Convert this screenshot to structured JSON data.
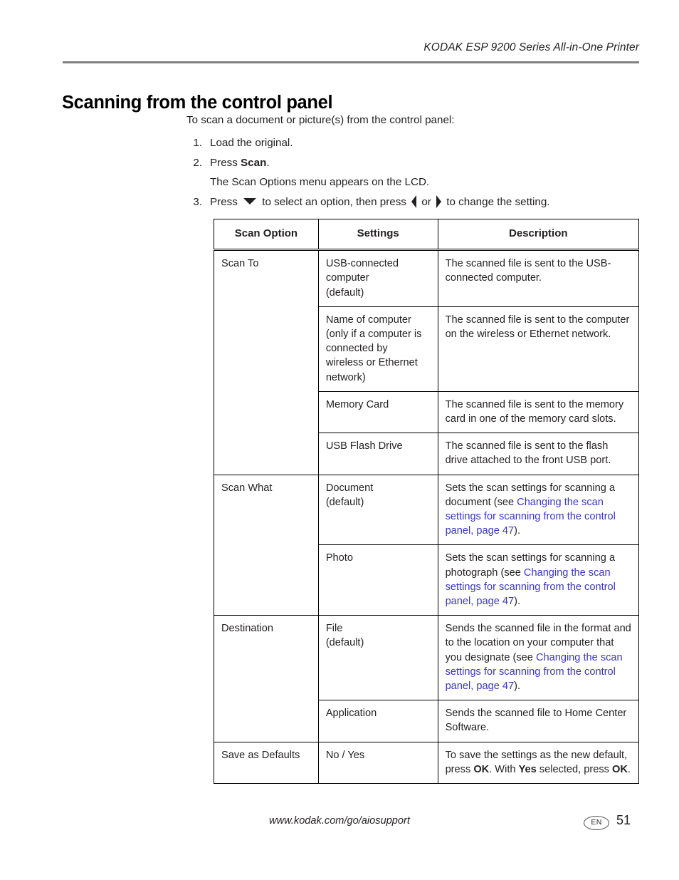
{
  "running_header": "KODAK ESP 9200 Series All-in-One Printer",
  "title": "Scanning from the control panel",
  "intro": "To scan a document or picture(s) from the control panel:",
  "steps": {
    "n1": "1.",
    "s1": "Load the original.",
    "n2": "2.",
    "s2_a": "Press ",
    "s2_b": "Scan",
    "s2_c": ".",
    "s2_sub": "The Scan Options menu appears on the LCD.",
    "n3": "3.",
    "s3_a": "Press ",
    "s3_b": " to select an option, then press ",
    "s3_c": " or ",
    "s3_d": " to change the setting."
  },
  "link_color": "#3a36c8",
  "rule_color": "#808080",
  "table": {
    "headers": {
      "option": "Scan Option",
      "settings": "Settings",
      "description": "Description"
    },
    "groups": [
      {
        "option": "Scan To",
        "rows": [
          {
            "setting": "USB-connected\ncomputer\n(default)",
            "desc_pre": "The scanned file is sent to the USB-connected computer.",
            "link": "",
            "desc_post": ""
          },
          {
            "setting": "Name of computer\n(only if a computer is\nconnected by\nwireless or Ethernet\nnetwork)",
            "desc_pre": "The scanned file is sent to the computer on the wireless or Ethernet network.",
            "link": "",
            "desc_post": ""
          },
          {
            "setting": "Memory Card",
            "desc_pre": "The scanned file is sent to the memory card in one of the memory card slots.",
            "link": "",
            "desc_post": ""
          },
          {
            "setting": "USB Flash Drive",
            "desc_pre": "The scanned file is sent to the flash drive attached to the front USB port.",
            "link": "",
            "desc_post": ""
          }
        ]
      },
      {
        "option": "Scan What",
        "rows": [
          {
            "setting": "Document\n(default)",
            "desc_pre": "Sets the scan settings for scanning a document (see ",
            "link": "Changing the scan settings for scanning from the control panel, page 47",
            "desc_post": ")."
          },
          {
            "setting": "Photo",
            "desc_pre": "Sets the scan settings for scanning a photograph (see ",
            "link": "Changing the scan settings for scanning from the control panel, page 47",
            "desc_post": ")."
          }
        ]
      },
      {
        "option": "Destination",
        "rows": [
          {
            "setting": "File\n(default)",
            "desc_pre": "Sends the scanned file in the format and to the location on your computer that you designate (see ",
            "link": "Changing the scan settings for scanning from the control panel, page 47",
            "desc_post": ")."
          },
          {
            "setting": "Application",
            "desc_pre": "Sends the scanned file to Home Center Software.",
            "link": "",
            "desc_post": ""
          }
        ]
      },
      {
        "option": "Save as Defaults",
        "rows": [
          {
            "setting": "No / Yes",
            "desc_pre": "To save the settings as the new default, press ",
            "bold1": "OK",
            "mid1": ". With ",
            "bold2": "Yes",
            "mid2": " selected, press ",
            "bold3": "OK",
            "desc_post": "."
          }
        ]
      }
    ]
  },
  "footer": {
    "url": "www.kodak.com/go/aiosupport",
    "language_badge": "EN",
    "page_number": "51"
  }
}
